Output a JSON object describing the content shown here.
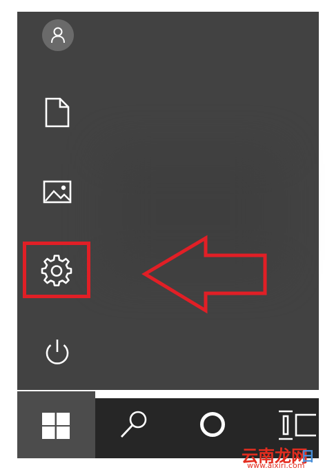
{
  "start_menu": {
    "rail_items": [
      {
        "icon": "user-icon"
      },
      {
        "icon": "document-icon"
      },
      {
        "icon": "pictures-icon"
      },
      {
        "icon": "gear-icon"
      },
      {
        "icon": "power-icon"
      }
    ],
    "highlighted_item": "gear-icon"
  },
  "taskbar": {
    "items": [
      {
        "icon": "windows-logo-icon"
      },
      {
        "icon": "search-icon"
      },
      {
        "icon": "cortana-icon"
      },
      {
        "icon": "task-view-icon"
      }
    ]
  },
  "annotation": {
    "color": "#e11f26",
    "arrow_direction": "left"
  },
  "watermark": {
    "main": "云南龙网",
    "sub": "日",
    "url": "www.aixiri.com"
  },
  "colors": {
    "panel": "#424242",
    "taskbar": "#262626",
    "start_tile": "#4c4c4c",
    "icon": "#ffffff"
  }
}
